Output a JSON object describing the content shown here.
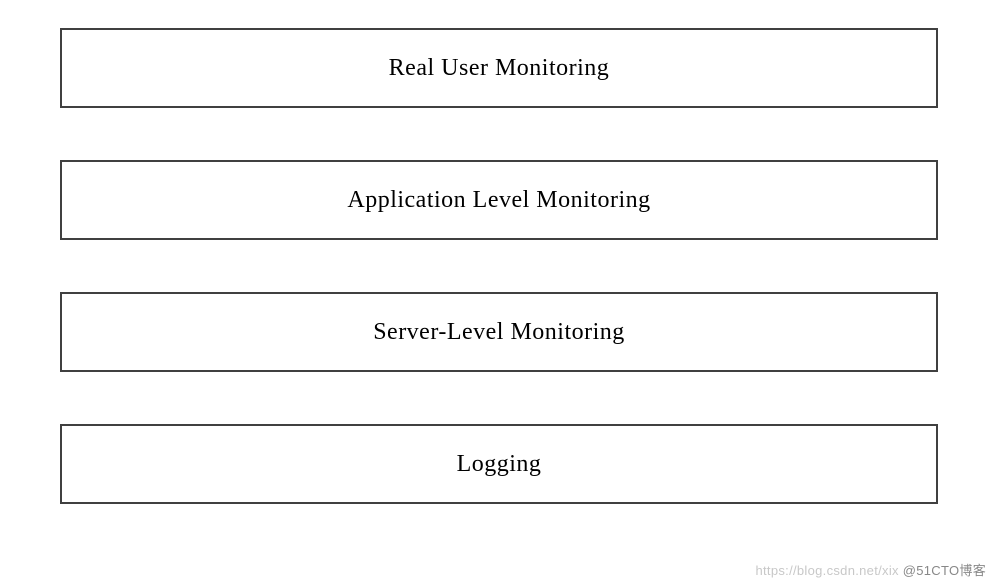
{
  "boxes": [
    {
      "label": "Real User Monitoring"
    },
    {
      "label": "Application Level Monitoring"
    },
    {
      "label": "Server-Level Monitoring"
    },
    {
      "label": "Logging"
    }
  ],
  "watermark": {
    "faint": "https://blog.csdn.net/xix ",
    "dark": "@51CTO博客"
  }
}
